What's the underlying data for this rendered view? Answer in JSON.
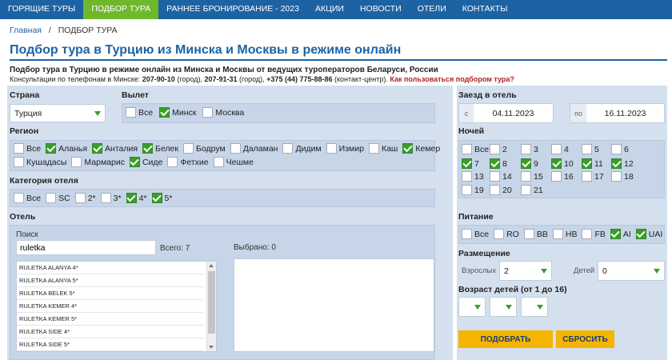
{
  "nav": [
    "ГОРЯЩИЕ ТУРЫ",
    "ПОДБОР ТУРА",
    "РАННЕЕ БРОНИРОВАНИЕ - 2023",
    "АКЦИИ",
    "НОВОСТИ",
    "ОТЕЛИ",
    "КОНТАКТЫ"
  ],
  "breadcrumb": {
    "home": "Главная",
    "sep": "/",
    "current": "ПОДБОР ТУРА"
  },
  "page_title": "Подбор тура в Турцию из Минска и Москвы в режиме онлайн",
  "subtitle": "Подбор тура в Турцию в режиме онлайн из Минска и Москвы от ведущих туроператоров Беларуси, России",
  "consult": {
    "prefix": "Консультации по телефонам в Минске: ",
    "p1": "207-90-10",
    "p1s": " (город), ",
    "p2": "207-91-31",
    "p2s": " (город), ",
    "p3": "+375 (44) 775-88-86",
    "p3s": " (контакт-центр). ",
    "howto": "Как пользоваться подбором тура?"
  },
  "country": {
    "label": "Страна",
    "value": "Турция"
  },
  "departure": {
    "label": "Вылет",
    "options": [
      {
        "t": "Все",
        "c": false
      },
      {
        "t": "Минск",
        "c": true
      },
      {
        "t": "Москва",
        "c": false
      }
    ]
  },
  "region": {
    "label": "Регион",
    "row1": [
      {
        "t": "Все",
        "c": false
      },
      {
        "t": "Аланья",
        "c": true
      },
      {
        "t": "Анталия",
        "c": true
      },
      {
        "t": "Белек",
        "c": true
      },
      {
        "t": "Бодрум",
        "c": false
      },
      {
        "t": "Даламан",
        "c": false
      },
      {
        "t": "Дидим",
        "c": false
      },
      {
        "t": "Измир",
        "c": false
      },
      {
        "t": "Каш",
        "c": false
      },
      {
        "t": "Кемер",
        "c": true
      }
    ],
    "row2": [
      {
        "t": "Кушадасы",
        "c": false
      },
      {
        "t": "Мармарис",
        "c": false
      },
      {
        "t": "Сиде",
        "c": true
      },
      {
        "t": "Фетхие",
        "c": false
      },
      {
        "t": "Чешме",
        "c": false
      }
    ]
  },
  "category": {
    "label": "Категория отеля",
    "options": [
      {
        "t": "Все",
        "c": false
      },
      {
        "t": "SC",
        "c": false
      },
      {
        "t": "2*",
        "c": false
      },
      {
        "t": "3*",
        "c": false
      },
      {
        "t": "4*",
        "c": true
      },
      {
        "t": "5*",
        "c": true
      }
    ]
  },
  "hotel": {
    "label": "Отель",
    "search_label": "Поиск",
    "search_value": "ruletka",
    "total": "Всего: 7",
    "selected": "Выбрано: 0",
    "items": [
      "RULETKA ALANYA 4*",
      "RULETKA ALANYA 5*",
      "RULETKA BELEK 5*",
      "RULETKA KEMER 4*",
      "RULETKA KEMER 5*",
      "RULETKA SIDE 4*",
      "RULETKA SIDE 5*"
    ]
  },
  "checkin": {
    "label": "Заезд в отель",
    "from_prefix": "с",
    "from": "04.11.2023",
    "to_prefix": "по",
    "to": "16.11.2023"
  },
  "nights": {
    "label": "Ночей",
    "options": [
      {
        "t": "Все",
        "c": false
      },
      {
        "t": "2",
        "c": false
      },
      {
        "t": "3",
        "c": false
      },
      {
        "t": "4",
        "c": false
      },
      {
        "t": "5",
        "c": false
      },
      {
        "t": "6",
        "c": false
      },
      {
        "t": "7",
        "c": true
      },
      {
        "t": "8",
        "c": true
      },
      {
        "t": "9",
        "c": true
      },
      {
        "t": "10",
        "c": true
      },
      {
        "t": "11",
        "c": true
      },
      {
        "t": "12",
        "c": true
      },
      {
        "t": "13",
        "c": false
      },
      {
        "t": "14",
        "c": false
      },
      {
        "t": "15",
        "c": false
      },
      {
        "t": "16",
        "c": false
      },
      {
        "t": "17",
        "c": false
      },
      {
        "t": "18",
        "c": false
      },
      {
        "t": "19",
        "c": false
      },
      {
        "t": "20",
        "c": false
      },
      {
        "t": "21",
        "c": false
      }
    ]
  },
  "meals": {
    "label": "Питание",
    "options": [
      {
        "t": "Все",
        "c": false
      },
      {
        "t": "RO",
        "c": false
      },
      {
        "t": "BB",
        "c": false
      },
      {
        "t": "HB",
        "c": false
      },
      {
        "t": "FB",
        "c": false
      },
      {
        "t": "AI",
        "c": true
      },
      {
        "t": "UAI",
        "c": true
      }
    ]
  },
  "accommodation": {
    "label": "Размещение",
    "adults_label": "Взрослых",
    "adults": "2",
    "kids_label": "Детей",
    "kids": "0"
  },
  "kids_age": {
    "label": "Возраст детей (от 1 до 16)"
  },
  "buttons": {
    "search": "ПОДОБРАТЬ",
    "reset": "СБРОСИТЬ"
  },
  "colors": {
    "nav": "#1d63a4",
    "nav_active": "#6fb82c",
    "panel": "#d4e0ee",
    "check": "#3a9d2a",
    "button": "#f5b400"
  }
}
